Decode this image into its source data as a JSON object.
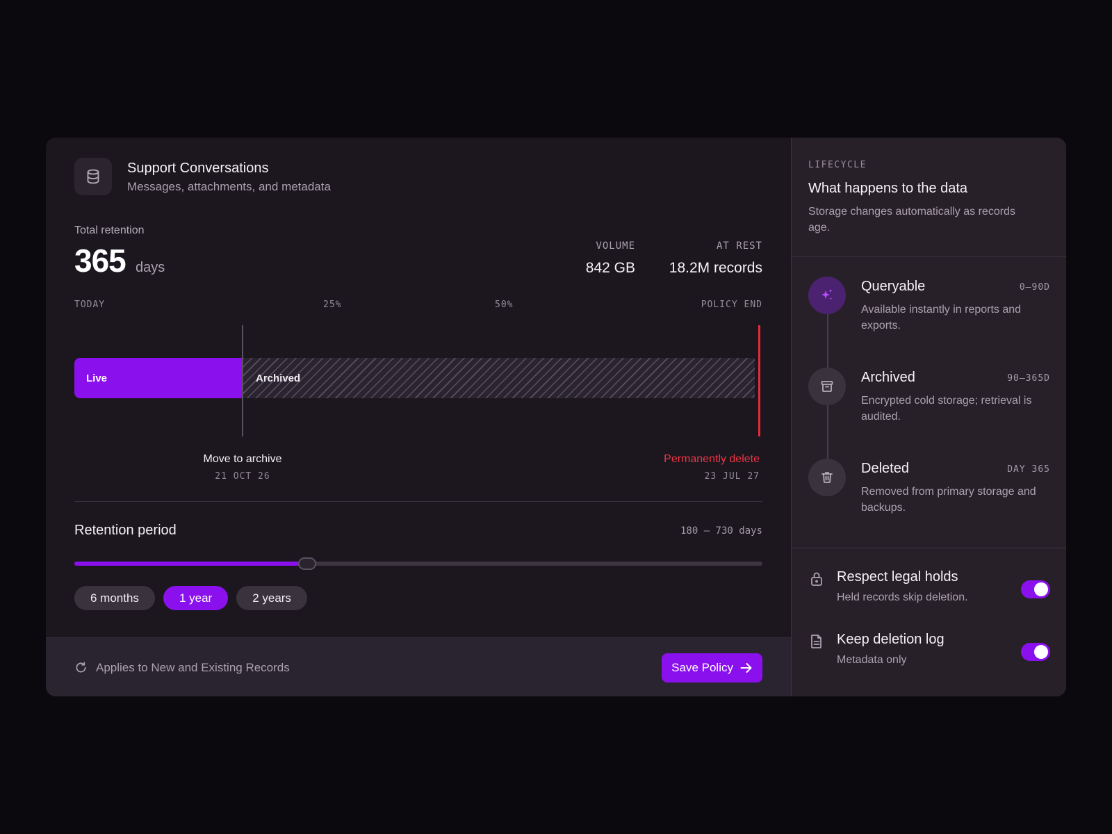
{
  "dataset": {
    "title": "Support Conversations",
    "subtitle": "Messages, attachments, and metadata",
    "icon": "database-icon"
  },
  "retention": {
    "label": "Total retention",
    "value": "365",
    "unit": "days"
  },
  "stats": [
    {
      "label": "VOLUME",
      "value": "842 GB"
    },
    {
      "label": "AT REST",
      "value": "18.2M records"
    }
  ],
  "timeline": {
    "ticks": {
      "start": "TODAY",
      "q1": "25%",
      "q2": "50%",
      "end": "POLICY END"
    },
    "live_label": "Live",
    "archived_label": "Archived",
    "archive_fraction": 0.245,
    "events": {
      "archive": {
        "title": "Move to archive",
        "date": "21 OCT 26"
      },
      "delete": {
        "title": "Permanently delete",
        "date": "23 JUL 27"
      }
    }
  },
  "period": {
    "title": "Retention period",
    "range": "180 – 730 days",
    "slider_fraction": 0.338,
    "chips": [
      {
        "label": "6 months",
        "active": false
      },
      {
        "label": "1 year",
        "active": true
      },
      {
        "label": "2 years",
        "active": false
      }
    ]
  },
  "footer": {
    "note": "Applies to New and Existing Records",
    "save_label": "Save Policy"
  },
  "lifecycle": {
    "eyebrow": "LIFECYCLE",
    "title": "What happens to the data",
    "description": "Storage changes automatically as records age.",
    "stages": [
      {
        "name": "Queryable",
        "range": "0–90D",
        "description": "Available instantly in reports and exports.",
        "icon": "sparkle-icon"
      },
      {
        "name": "Archived",
        "range": "90–365D",
        "description": "Encrypted cold storage; retrieval is audited.",
        "icon": "archive-box-icon"
      },
      {
        "name": "Deleted",
        "range": "DAY 365",
        "description": "Removed from primary storage and backups.",
        "icon": "trash-icon"
      }
    ]
  },
  "options": [
    {
      "title": "Respect legal holds",
      "subtitle": "Held records skip deletion.",
      "enabled": true,
      "icon": "lock-icon"
    },
    {
      "title": "Keep deletion log",
      "subtitle": "Metadata only",
      "enabled": true,
      "icon": "document-icon"
    }
  ],
  "colors": {
    "accent": "#8b10ee",
    "danger": "#e52a3b",
    "background": "#0b090d",
    "card": "#1c171f",
    "panel": "#282029"
  }
}
